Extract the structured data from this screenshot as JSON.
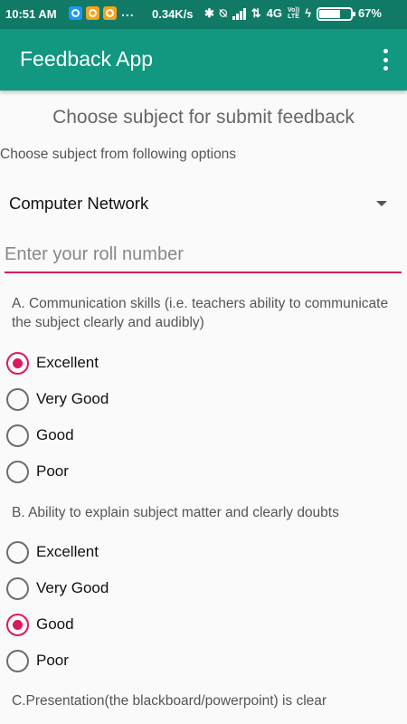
{
  "status_bar": {
    "time": "10:51 AM",
    "dots": "...",
    "speed": "0.34K/s",
    "network": "4G",
    "volte_top": "Vo))",
    "volte_bottom": "LTE",
    "battery": "67%",
    "battery_level": 0.67
  },
  "app_bar": {
    "title": "Feedback App"
  },
  "heading": "Choose subject for submit feedback",
  "subheading": "Choose subject from following options",
  "spinner": {
    "selected": "Computer Network"
  },
  "roll_input": {
    "placeholder": "Enter your roll number",
    "value": ""
  },
  "questions": [
    {
      "text": "A. Communication skills (i.e. teachers ability to communicate the subject clearly and audibly)",
      "options": [
        "Excellent",
        "Very Good",
        "Good",
        "Poor"
      ],
      "selected": "Excellent"
    },
    {
      "text": "B. Ability to explain subject matter and clearly doubts",
      "options": [
        "Excellent",
        "Very Good",
        "Good",
        "Poor"
      ],
      "selected": "Good"
    },
    {
      "text": "C.Presentation(the blackboard/powerpoint) is clear"
    }
  ],
  "colors": {
    "status_bar": "#107a66",
    "app_bar": "#129781",
    "accent": "#d81b60"
  }
}
